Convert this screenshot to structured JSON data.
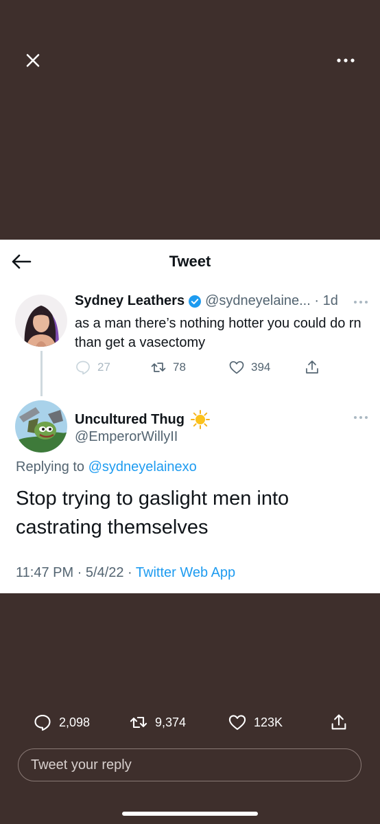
{
  "icons": {
    "close": "close-icon",
    "more": "more-icon",
    "back": "back-arrow-icon",
    "verified": "verified-badge-icon",
    "reply": "reply-icon",
    "retweet": "retweet-icon",
    "like": "heart-icon",
    "share": "share-icon",
    "sun": "sun-emoji"
  },
  "colors": {
    "background": "#3e2f2c",
    "card": "#ffffff",
    "accent": "#1d9bf0",
    "muted": "#536471"
  },
  "header": {
    "title": "Tweet"
  },
  "parent_tweet": {
    "name": "Sydney Leathers",
    "handle_time": "@sydneyelaine... · 1d",
    "text": "as a man there’s nothing hotter you could do rn than get a vasectomy",
    "replies": "27",
    "retweets": "78",
    "likes": "394"
  },
  "reply_tweet": {
    "name": "Uncultured Thug",
    "handle": "@EmperorWillyII",
    "replying_prefix": "Replying to ",
    "replying_handle": "@sydneyelainexo",
    "text": "Stop trying to gaslight men into castrating themselves",
    "time_date": "11:47 PM · 5/4/22 · ",
    "source": "Twitter Web App"
  },
  "engagement": {
    "replies": "2,098",
    "retweets": "9,374",
    "likes": "123K"
  },
  "reply_input": {
    "placeholder": "Tweet your reply"
  }
}
